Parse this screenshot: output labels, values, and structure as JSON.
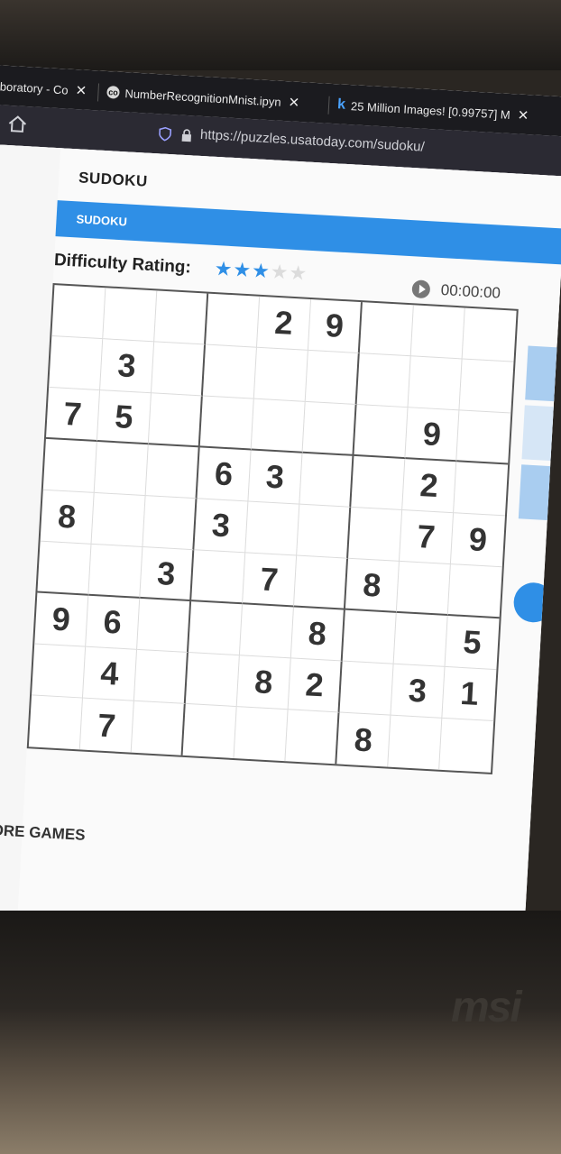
{
  "browser": {
    "tabs": [
      {
        "label": "aboratory - Co",
        "icon": "colab-icon"
      },
      {
        "label": "NumberRecognitionMnist.ipyn",
        "icon": "colab-icon"
      },
      {
        "label": "25 Million Images! [0.99757] M",
        "icon": "kaggle-k-icon"
      }
    ],
    "url": "https://puzzles.usatoday.com/sudoku/"
  },
  "page": {
    "title": "SUDOKU",
    "nav_label": "SUDOKU",
    "difficulty_label": "Difficulty Rating:",
    "difficulty": {
      "rating": 3,
      "max": 5
    },
    "timer": "00:00:00",
    "more_games": "MORE GAMES"
  },
  "board": [
    [
      "",
      "",
      "",
      "",
      "2",
      "9",
      "",
      "",
      ""
    ],
    [
      "",
      "3",
      "",
      "",
      "",
      "",
      "",
      "",
      ""
    ],
    [
      "7",
      "5",
      "",
      "",
      "",
      "",
      "",
      "9",
      ""
    ],
    [
      "",
      "",
      "",
      "6",
      "3",
      "",
      "",
      "2",
      ""
    ],
    [
      "8",
      "",
      "",
      "3",
      "",
      "",
      "",
      "7",
      "9"
    ],
    [
      "",
      "",
      "3",
      "",
      "7",
      "",
      "8",
      "",
      ""
    ],
    [
      "9",
      "6",
      "",
      "",
      "",
      "8",
      "",
      "",
      "5"
    ],
    [
      "",
      "4",
      "",
      "",
      "8",
      "2",
      "",
      "3",
      "1"
    ],
    [
      "",
      "7",
      "",
      "",
      "",
      "",
      "8",
      "",
      ""
    ]
  ],
  "colors": {
    "accent": "#2f8fe6",
    "star_off": "#dcdcdc"
  }
}
